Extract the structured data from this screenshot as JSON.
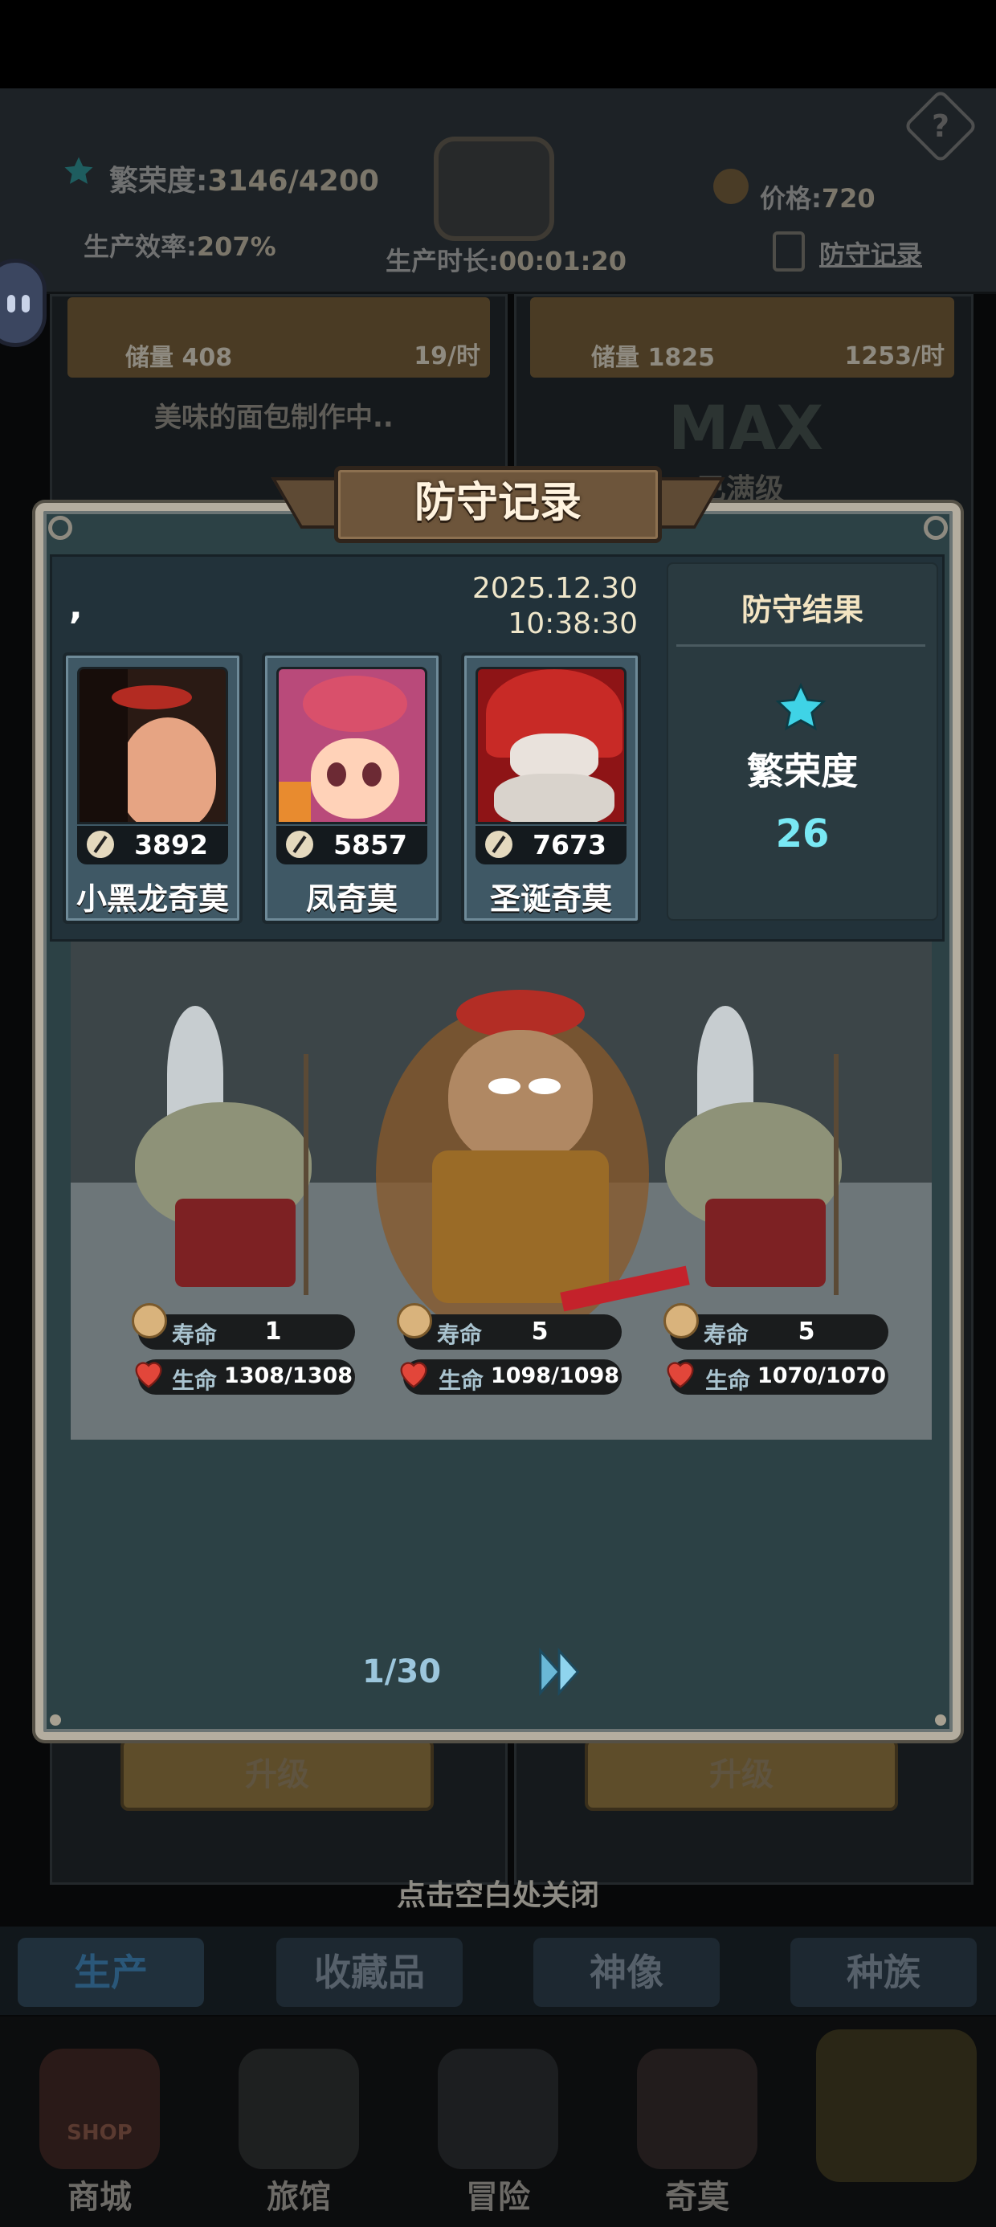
{
  "background": {
    "header": {
      "prosperity_label": "繁荣度:",
      "prosperity_value": "3146/4200",
      "efficiency_label": "生产效率:",
      "efficiency_value": "207%",
      "duration_label": "生产时长:",
      "duration_value": "00:01:20",
      "price_label": "价格:",
      "price_value": "720",
      "defense_record_link": "防守记录",
      "help_icon": "?"
    },
    "cards": [
      {
        "stock_label": "储量",
        "stock_value": "408",
        "rate_value": "19",
        "rate_unit": "/时",
        "status": "美味的面包制作中.."
      },
      {
        "stock_label": "储量",
        "stock_value": "1825",
        "rate_value": "1253",
        "rate_unit": "/时",
        "status": "MAX",
        "status_sub": "已满级"
      }
    ],
    "upgrade_buttons": [
      "升级",
      "升级"
    ],
    "close_hint": "点击空白处关闭",
    "tabs": [
      "生产",
      "收藏品",
      "神像",
      "种族"
    ],
    "nav": [
      {
        "label": "商城",
        "icon": "shop-icon",
        "badge": "SHOP"
      },
      {
        "label": "旅馆",
        "icon": "inn-icon"
      },
      {
        "label": "冒险",
        "icon": "crossed-swords-icon"
      },
      {
        "label": "奇莫",
        "icon": "monster-icon"
      },
      {
        "label": "",
        "icon": "home-island-icon"
      }
    ]
  },
  "dialog": {
    "title": "防守记录",
    "attacker_name": ",",
    "date": "2025.12.30",
    "time": "10:38:30",
    "result": {
      "title": "防守结果",
      "label": "繁荣度",
      "value": "26",
      "icon": "star-icon"
    },
    "heroes": [
      {
        "name": "小黑龙奇莫",
        "power": "3892",
        "icon": "sword-icon",
        "portrait": "bald-head-portrait"
      },
      {
        "name": "凤奇莫",
        "power": "5857",
        "icon": "sword-icon",
        "portrait": "phoenix-hood-portrait"
      },
      {
        "name": "圣诞奇莫",
        "power": "7673",
        "icon": "sword-icon",
        "portrait": "santa-hood-portrait"
      }
    ],
    "units": [
      {
        "life_label": "寿命",
        "life": "1",
        "hp_label": "生命",
        "hp": "1308/1308",
        "hp_fraction": 1.0
      },
      {
        "life_label": "寿命",
        "life": "5",
        "hp_label": "生命",
        "hp": "1098/1098",
        "hp_fraction": 1.0
      },
      {
        "life_label": "寿命",
        "life": "5",
        "hp_label": "生命",
        "hp": "1070/1070",
        "hp_fraction": 1.0
      }
    ],
    "pager": "1/30",
    "next_icon": "double-chevron-right-icon"
  },
  "colors": {
    "dialog_bg": "#2c4145",
    "accent_cyan": "#79e8f4",
    "title_gold": "#f3e4c2",
    "border_light": "#b4ad9f"
  }
}
